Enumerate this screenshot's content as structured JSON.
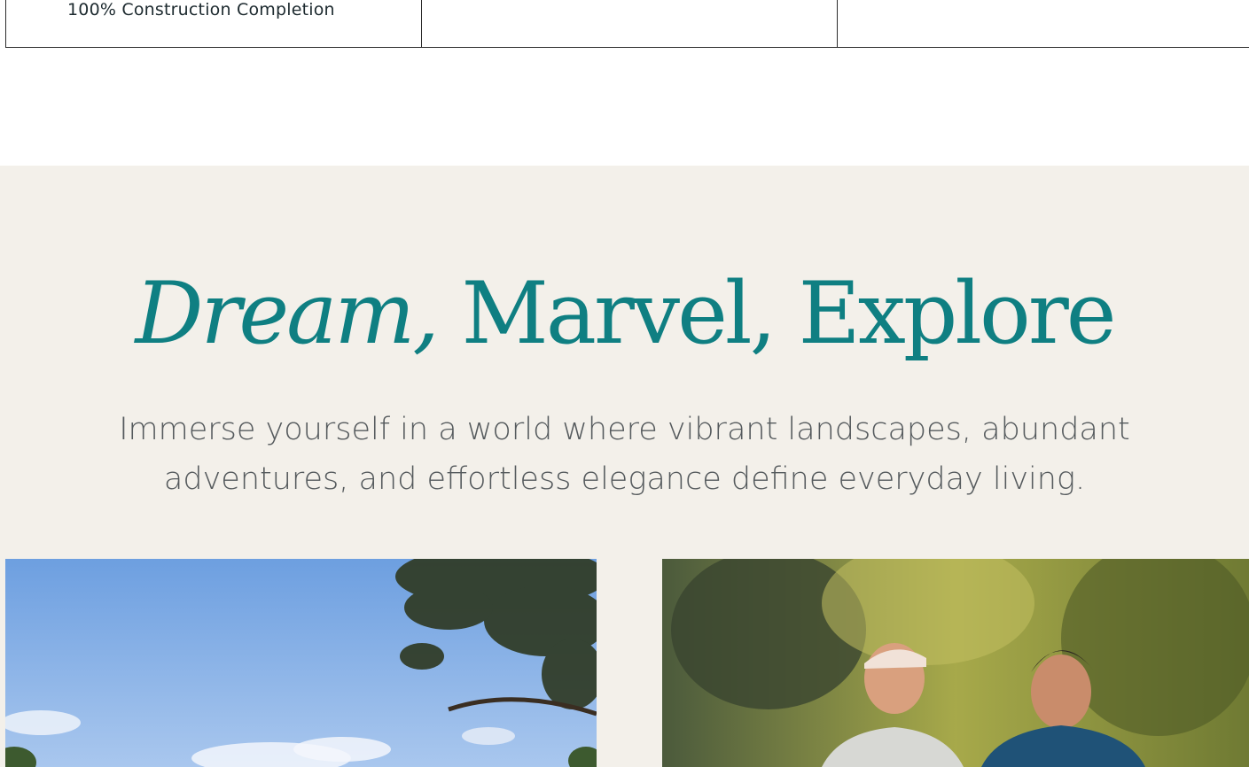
{
  "table": {
    "row": {
      "col1": "100% Construction Completion",
      "col2": "",
      "col3": ""
    }
  },
  "feature": {
    "headline_accent": "Dream,",
    "headline_rest": " Marvel, Explore",
    "subtext_line1": "Immerse yourself in a world where vibrant landscapes, abundant",
    "subtext_line2": "adventures, and effortless elegance define everyday living."
  },
  "colors": {
    "accent_teal": "#0f7f82",
    "section_bg": "#f3f0ea",
    "body_text": "#555a5d"
  }
}
